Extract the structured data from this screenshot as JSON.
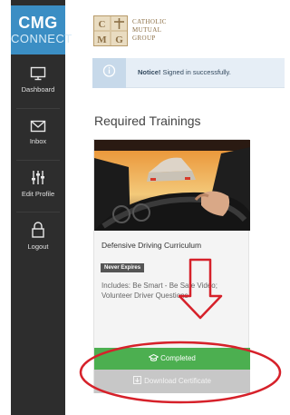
{
  "brand": {
    "line1": "CMG",
    "line2": "CONNECT"
  },
  "sidebar": {
    "items": [
      {
        "label": "Dashboard",
        "icon": "monitor-icon"
      },
      {
        "label": "Inbox",
        "icon": "envelope-icon"
      },
      {
        "label": "Edit Profile",
        "icon": "sliders-icon"
      },
      {
        "label": "Logout",
        "icon": "lock-icon"
      }
    ]
  },
  "header": {
    "logo_lines": [
      "CATHOLIC",
      "MUTUAL",
      "GROUP"
    ]
  },
  "notice": {
    "label": "Notice!",
    "message": "Signed in successfully.",
    "icon": "info-icon"
  },
  "main": {
    "section_title": "Required Trainings",
    "card": {
      "title": "Defensive Driving Curriculum",
      "badge": "Never Expires",
      "description": "Includes: Be Smart - Be Safe Video; Volunteer Driver Questions",
      "completed_label": "Completed",
      "completed_icon": "graduation-cap-icon",
      "download_label": "Download Certificate",
      "download_icon": "download-icon"
    }
  },
  "colors": {
    "brand_blue": "#3b8ec4",
    "sidebar_bg": "#2d2d2d",
    "completed_green": "#4caf50",
    "annotation_red": "#d6212a"
  }
}
